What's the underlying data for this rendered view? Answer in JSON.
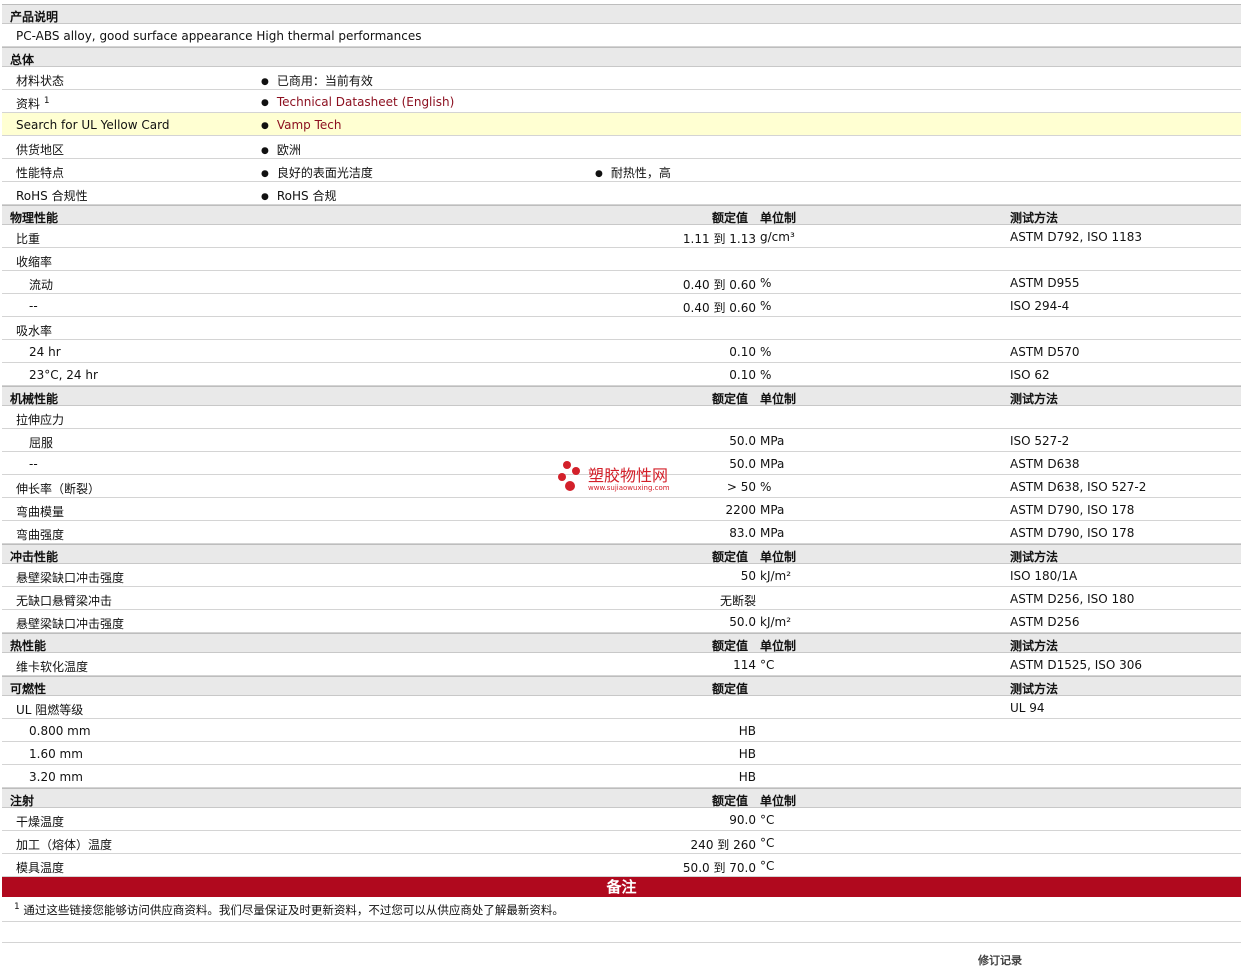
{
  "sections": {
    "description": "产品说明",
    "description_text": "PC-ABS alloy, good surface appearance High thermal performances",
    "general": "总体",
    "physical": "物理性能",
    "mechanical": "机械性能",
    "impact": "冲击性能",
    "thermal": "热性能",
    "flammability": "可燃性",
    "injection": "注射"
  },
  "headers": {
    "value": "额定值",
    "unit": "单位制",
    "method": "测试方法"
  },
  "general": {
    "material_status_label": "材料状态",
    "material_status_value": "已商用：当前有效",
    "docs_label": "资料",
    "docs_sup": "1",
    "docs_link": "Technical Datasheet (English)",
    "ul_label": "Search for UL Yellow Card",
    "ul_link": "Vamp Tech",
    "region_label": "供货地区",
    "region_value": "欧洲",
    "features_label": "性能特点",
    "features_value1": "良好的表面光洁度",
    "features_value2": "耐热性，高",
    "rohs_label": "RoHS 合规性",
    "rohs_value": "RoHS 合规"
  },
  "physical": {
    "sg": {
      "label": "比重",
      "value": "1.11 到  1.13",
      "unit": "g/cm³",
      "method": "ASTM D792, ISO 1183"
    },
    "shrink": {
      "label": "收缩率"
    },
    "flow": {
      "label": "流动",
      "value": "0.40 到  0.60",
      "unit": "%",
      "method": "ASTM D955"
    },
    "dash": {
      "label": "--",
      "value": "0.40 到  0.60",
      "unit": "%",
      "method": "ISO 294-4"
    },
    "water": {
      "label": "吸水率"
    },
    "w24": {
      "label": "24 hr",
      "value": "0.10",
      "unit": "%",
      "method": "ASTM D570"
    },
    "w23": {
      "label": "23°C, 24 hr",
      "value": "0.10",
      "unit": "%",
      "method": "ISO 62"
    }
  },
  "mechanical": {
    "tensile": {
      "label": "拉伸应力"
    },
    "yield": {
      "label": "屈服",
      "value": "50.0",
      "unit": "MPa",
      "method": "ISO 527-2"
    },
    "dash": {
      "label": "--",
      "value": "50.0",
      "unit": "MPa",
      "method": "ASTM D638"
    },
    "elong": {
      "label": "伸长率（断裂）",
      "value": "> 50",
      "unit": "%",
      "method": "ASTM D638, ISO 527-2"
    },
    "flexmod": {
      "label": "弯曲模量",
      "value": "2200",
      "unit": "MPa",
      "method": "ASTM D790, ISO 178"
    },
    "flexstr": {
      "label": "弯曲强度",
      "value": "83.0",
      "unit": "MPa",
      "method": "ASTM D790, ISO 178"
    }
  },
  "impact": {
    "izod1": {
      "label": "悬壁梁缺口冲击强度",
      "value": "50",
      "unit": "kJ/m²",
      "method": "ISO 180/1A"
    },
    "unnotched": {
      "label": "无缺口悬臂梁冲击",
      "value": "无断裂",
      "unit": "",
      "method": "ASTM D256, ISO 180"
    },
    "izod2": {
      "label": "悬壁梁缺口冲击强度",
      "value": "50.0",
      "unit": "kJ/m²",
      "method": "ASTM D256"
    }
  },
  "thermal": {
    "vicat": {
      "label": "维卡软化温度",
      "value": "114",
      "unit": "°C",
      "method": "ASTM D1525, ISO 306"
    }
  },
  "flammability": {
    "ul": {
      "label": "UL 阻燃等级",
      "method": "UL 94"
    },
    "t08": {
      "label": "0.800 mm",
      "value": "HB"
    },
    "t16": {
      "label": "1.60 mm",
      "value": "HB"
    },
    "t32": {
      "label": "3.20 mm",
      "value": "HB"
    }
  },
  "injection": {
    "dry": {
      "label": "干燥温度",
      "value": "90.0",
      "unit": "°C"
    },
    "melt": {
      "label": "加工（熔体）温度",
      "value": "240 到  260",
      "unit": "°C"
    },
    "mold": {
      "label": "模具温度",
      "value": "50.0 到  70.0",
      "unit": "°C"
    }
  },
  "notes": {
    "banner": "备注",
    "sup": "1",
    "text": "通过这些链接您能够访问供应商资料。我们尽量保证及时更新资料，不过您可以从供应商处了解最新资料。"
  },
  "watermark": {
    "title": "塑胶物性网",
    "url": "www.sujiaowuxing.com"
  },
  "footer_cut": "修订记录"
}
